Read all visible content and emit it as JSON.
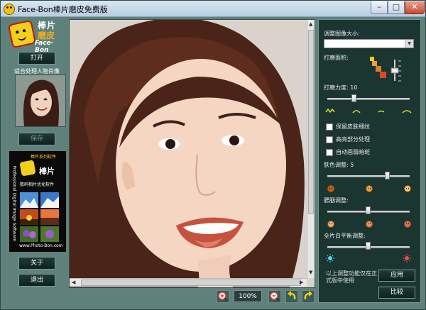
{
  "window": {
    "title": "Face-Bon棒片磨皮免费版",
    "min_label": "–",
    "max_label": "□",
    "close_label": "✕"
  },
  "logo": {
    "line1": "棒片",
    "line2": "磨皮",
    "line3": "Face-Bon"
  },
  "left": {
    "open_label": "打开",
    "caption": "适合处理人物肖像",
    "save_label": "保存",
    "about_label": "关于",
    "exit_label": "退出"
  },
  "ad": {
    "top_text": "棒片系列软件",
    "big_text": "棒片",
    "sub_text": "数码相片优化软件",
    "vertical_text": "Professional Digital Image Software",
    "url": "www.Photo-Bon.com"
  },
  "toolbar": {
    "zoom_value": "100%",
    "zoom_in_icon": "zoom-in-icon",
    "zoom_out_icon": "zoom-out-icon"
  },
  "right": {
    "size_label": "调整图像大小:",
    "size_value": "",
    "area_label": "打磨面积:",
    "strength_label": "打磨力度: 10",
    "strength_value": 10,
    "opt1": "保留皮肤细纹",
    "opt2": "高亮部分处理",
    "opt3": "自动画弱暗斑",
    "skin_label": "肤色调整: 5",
    "skin_value": 5,
    "blush_label": "腮胭调整:",
    "wb_label": "全片白平衡调整:",
    "note": "以上调整功能仅在正式版中使用",
    "apply_label": "应用",
    "compare_label": "比较"
  },
  "colors": {
    "panel_bg": "#5e827b",
    "dark_panel": "#1b3531",
    "accent": "#f3b01c"
  }
}
